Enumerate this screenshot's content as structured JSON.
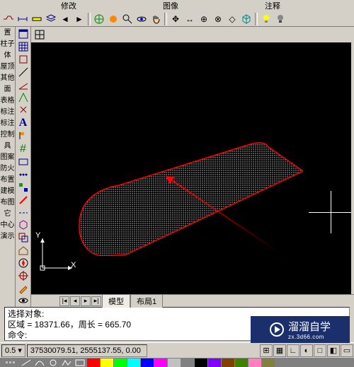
{
  "menu": {
    "modify": "修改",
    "image": "图像",
    "annotate": "注释"
  },
  "top_toolbar_icons": [
    "polyline-icon",
    "dimension-icon",
    "ruler-icon",
    "layers-icon",
    "leftarrow-icon",
    "rightarrow-icon",
    "sep",
    "globe-icon",
    "palette-icon",
    "zoom-icon",
    "orbit-icon",
    "hand-icon",
    "sep",
    "pan-arrows-icon",
    "move-icon",
    "nav-icon",
    "nav2-icon",
    "view-icon",
    "box3d-icon",
    "sep",
    "bulb-on-icon",
    "bulb-off-icon"
  ],
  "left_labels": [
    "置",
    "柱子",
    "体",
    "",
    "屋顶",
    "其他",
    "面",
    "表格",
    "标注",
    "标注",
    "控制",
    "具",
    "图案",
    "防火",
    "布置",
    "建模",
    "布图",
    "它",
    "中心",
    "演示"
  ],
  "left_tools": [
    "window-icon",
    "grid-icon",
    "box-icon",
    "line-icon",
    "slope-icon",
    "angle-icon",
    "tick-icon",
    "text-icon",
    "flag-icon",
    "hash-icon",
    "window2-icon",
    "dots-icon",
    "blocks-icon",
    "slash-icon",
    "dash-icon",
    "cube-icon",
    "overlap-icon",
    "house-icon",
    "compass-icon",
    "crosshair-icon",
    "pencil-icon",
    "eye-icon"
  ],
  "ucs": {
    "x": "X",
    "y": "Y"
  },
  "tabs": {
    "model": "模型",
    "layout1": "布局1"
  },
  "command": {
    "line1": "选择对象:",
    "line2": "区域 = 18371.66，周长 = 665.70",
    "prompt": "命令:"
  },
  "status": {
    "left_value": "0.5",
    "coords": "37530079.51, 2555137.55, 0.00"
  },
  "watermark": {
    "brand": "溜溜自学",
    "url": "zx.3d66.com"
  },
  "palette": [
    "#ff0000",
    "#ffff00",
    "#00ff00",
    "#00ffff",
    "#0000ff",
    "#ff00ff",
    "#c0c0c0",
    "#808080",
    "#000000",
    "#8000ff",
    "#804000",
    "#408000",
    "#ff80c0",
    "#808040"
  ]
}
